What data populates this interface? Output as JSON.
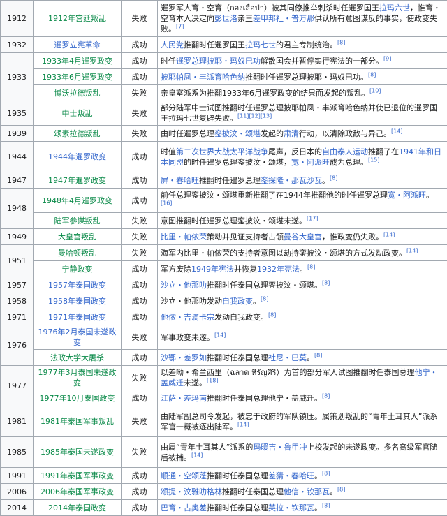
{
  "rows": [
    {
      "year": "1912",
      "event": "1912年宫廷叛乱",
      "event_link": true,
      "result": "失败",
      "desc": [
        {
          "t": "暹罗军人育・空育（",
          "c": "tx"
        },
        {
          "t": "กองเสือป่า",
          "c": "tx"
        },
        {
          "t": "）被其同僚推举刺杀时任暹罗国王",
          "c": "tx"
        },
        {
          "t": "拉玛六世",
          "c": "bl"
        },
        {
          "t": "，惟育・空育本人决定向",
          "c": "tx"
        },
        {
          "t": "彭世洛",
          "c": "bl"
        },
        {
          "t": "亲王",
          "c": "tx"
        },
        {
          "t": "差甲邦社・普万那",
          "c": "bl"
        },
        {
          "t": "供认所有意图谋反的事实，使政变失败。",
          "c": "tx"
        }
      ],
      "ref": "[7]"
    },
    {
      "year": "1932",
      "event": "暹罗立宪革命",
      "event_link": false,
      "result": "成功",
      "desc": [
        {
          "t": "人民党",
          "c": "bl"
        },
        {
          "t": "推翻时任暹罗国王",
          "c": "tx"
        },
        {
          "t": "拉玛七世",
          "c": "bl"
        },
        {
          "t": "的君主专制统治。",
          "c": "tx"
        }
      ],
      "ref": "[8]"
    },
    {
      "year": "1933",
      "event": "1933年4月暹罗政变",
      "event_link": true,
      "result": "成功",
      "desc": [
        {
          "t": "时任",
          "c": "tx"
        },
        {
          "t": "暹罗总理披耶・玛奴巴功",
          "c": "bl"
        },
        {
          "t": "解散国会并暂停实行宪法的一部分。",
          "c": "tx"
        }
      ],
      "ref": "[9]"
    },
    {
      "year": "",
      "event": "1933年6月暹罗政变",
      "event_link": true,
      "result": "成功",
      "desc": [
        {
          "t": "披耶帕凤・丰派育哈色纳",
          "c": "bl"
        },
        {
          "t": "推翻时任暹罗总理披耶・玛奴巴功。",
          "c": "tx"
        }
      ],
      "ref": "[8]"
    },
    {
      "year": "",
      "event": "博沃拉德叛乱",
      "event_link": true,
      "result": "失败",
      "desc": [
        {
          "t": "亲皇室派系为推翻1933年6月暹罗政变的结果而发起的叛乱。",
          "c": "tx"
        }
      ],
      "ref": "[10]"
    },
    {
      "year": "1935",
      "event": "中士叛乱",
      "event_link": true,
      "result": "失败",
      "desc": [
        {
          "t": "部分陆军中士试图推翻时任暹罗总理披耶帕凤・丰派育哈色纳并使已退位的暹罗国王拉玛七世复辟失败。",
          "c": "tx"
        }
      ],
      "ref": "[11][12][13]"
    },
    {
      "year": "1939",
      "event": "颂素拉德叛乱",
      "event_link": true,
      "result": "失败",
      "desc": [
        {
          "t": "由时任暹罗总理",
          "c": "tx"
        },
        {
          "t": "銮披汶・颂堪",
          "c": "bl"
        },
        {
          "t": "发起的",
          "c": "tx"
        },
        {
          "t": "肃清",
          "c": "bl"
        },
        {
          "t": "行动，以清除政敌与异己。",
          "c": "tx"
        }
      ],
      "ref": "[14]"
    },
    {
      "year": "1944",
      "event": "1944年暹罗政变",
      "event_link": false,
      "result": "成功",
      "desc": [
        {
          "t": "时值",
          "c": "tx"
        },
        {
          "t": "第二次世界大战太平洋战争",
          "c": "bl"
        },
        {
          "t": "尾声，反日本的",
          "c": "tx"
        },
        {
          "t": "自由泰人运动",
          "c": "bl"
        },
        {
          "t": "推翻了在",
          "c": "tx"
        },
        {
          "t": "1941年和日本同盟",
          "c": "bl"
        },
        {
          "t": "的时任暹罗总理銮披汶・颂堪，",
          "c": "tx"
        },
        {
          "t": "宽・阿派旺",
          "c": "bl"
        },
        {
          "t": "成为总理。",
          "c": "tx"
        }
      ],
      "ref": "[15]"
    },
    {
      "year": "1947",
      "event": "1947年暹罗政变",
      "event_link": true,
      "result": "成功",
      "desc": [
        {
          "t": "屏・春哈旺",
          "c": "bl"
        },
        {
          "t": "推翻时任暹罗总理",
          "c": "tx"
        },
        {
          "t": "銮探隆・那瓦沙瓦",
          "c": "bl"
        },
        {
          "t": "。",
          "c": "tx"
        }
      ],
      "ref": "[8]"
    },
    {
      "year": "1948",
      "event": "1948年4月暹罗政变",
      "event_link": true,
      "result": "成功",
      "desc": [
        {
          "t": "前任总理銮披汶・颂堪重新推翻了在1944年推翻他的时任暹罗总理",
          "c": "tx"
        },
        {
          "t": "宽・阿派旺",
          "c": "bl"
        },
        {
          "t": "。",
          "c": "tx"
        }
      ],
      "ref": "[16]"
    },
    {
      "year": "",
      "event": "陆军参谋叛乱",
      "event_link": true,
      "result": "失败",
      "desc": [
        {
          "t": "意图推翻时任暹罗总理銮披汶・颂堪未遂。",
          "c": "tx"
        }
      ],
      "ref": "[17]"
    },
    {
      "year": "1949",
      "event": "大皇宫叛乱",
      "event_link": true,
      "result": "失败",
      "desc": [
        {
          "t": "比里・帕侬荣",
          "c": "bl"
        },
        {
          "t": "策动并见证支持者占领",
          "c": "tx"
        },
        {
          "t": "曼谷大皇宫",
          "c": "bl"
        },
        {
          "t": "，惟政变仍失败。",
          "c": "tx"
        }
      ],
      "ref": "[14]"
    },
    {
      "year": "1951",
      "event": "曼哈顿叛乱",
      "event_link": true,
      "result": "失败",
      "desc": [
        {
          "t": "海军内比里・帕侬荣的支持者意图以劫持銮披汶・颂堪的方式发动政变。",
          "c": "tx"
        }
      ],
      "ref": "[14]"
    },
    {
      "year": "",
      "event": "宁静政变",
      "event_link": true,
      "result": "成功",
      "desc": [
        {
          "t": "军方废除",
          "c": "tx"
        },
        {
          "t": "1949年宪法",
          "c": "bl"
        },
        {
          "t": "并恢复",
          "c": "tx"
        },
        {
          "t": "1932年宪法",
          "c": "bl"
        },
        {
          "t": "。",
          "c": "tx"
        }
      ],
      "ref": "[8]"
    },
    {
      "year": "1957",
      "event": "1957年泰国政变",
      "event_link": false,
      "result": "成功",
      "desc": [
        {
          "t": "沙立・他那叻",
          "c": "bl"
        },
        {
          "t": "推翻时任泰国总理銮披汶・颂堪。",
          "c": "tx"
        }
      ],
      "ref": "[8]"
    },
    {
      "year": "1958",
      "event": "1958年泰国政变",
      "event_link": false,
      "result": "成功",
      "desc": [
        {
          "t": "沙立・他那叻发动",
          "c": "tx"
        },
        {
          "t": "自我政变",
          "c": "bl"
        },
        {
          "t": "。",
          "c": "tx"
        }
      ],
      "ref": "[8]"
    },
    {
      "year": "1971",
      "event": "1971年泰国政变",
      "event_link": false,
      "result": "成功",
      "desc": [
        {
          "t": "他侬・吉滴卡宗",
          "c": "bl"
        },
        {
          "t": "发动自我政变。",
          "c": "tx"
        }
      ],
      "ref": "[8]"
    },
    {
      "year": "1976",
      "event": "1976年2月泰国未遂政变",
      "event_link": false,
      "result": "失败",
      "desc": [
        {
          "t": "军事政变未遂。",
          "c": "tx"
        }
      ],
      "ref": "[14]"
    },
    {
      "year": "",
      "event": "法政大学大屠杀",
      "event_link": true,
      "result": "成功",
      "desc": [
        {
          "t": "沙鄂・差罗如",
          "c": "bl"
        },
        {
          "t": "推翻时任泰国总理",
          "c": "tx"
        },
        {
          "t": "社尼・巴莫",
          "c": "bl"
        },
        {
          "t": "。",
          "c": "tx"
        }
      ],
      "ref": "[8]"
    },
    {
      "year": "1977",
      "event": "1977年3月泰国未遂政变",
      "event_link": true,
      "result": "失败",
      "desc": [
        {
          "t": "以差呦・希兰西里（ฉลาด หิรัญศิริ）为首的部分军人试图推翻时任泰国总理",
          "c": "tx"
        },
        {
          "t": "他宁・盖威迁",
          "c": "bl"
        },
        {
          "t": "未遂。",
          "c": "tx"
        }
      ],
      "ref": "[18]"
    },
    {
      "year": "",
      "event": "1977年10月泰国政变",
      "event_link": true,
      "result": "成功",
      "desc": [
        {
          "t": "江萨・差玛南",
          "c": "bl"
        },
        {
          "t": "推翻时任泰国总理他宁・盖威迁。",
          "c": "tx"
        }
      ],
      "ref": "[8]"
    },
    {
      "year": "1981",
      "event": "1981年泰国军事叛乱",
      "event_link": true,
      "result": "失败",
      "desc": [
        {
          "t": "由陆军副总司令发起，被忠于政府的军队镇压。属策划叛乱的“青年土耳其人”派系军官一概被逐出陆军。",
          "c": "tx"
        }
      ],
      "ref": "[14]"
    },
    {
      "year": "1985",
      "event": "1985年泰国未遂政变",
      "event_link": true,
      "result": "失败",
      "desc": [
        {
          "t": "由属“青年土耳其人”派系的",
          "c": "tx"
        },
        {
          "t": "玛暖吉・鲁甲冲",
          "c": "bl"
        },
        {
          "t": "上校发起的未遂政变。多名高级军官随后被捕。",
          "c": "tx"
        }
      ],
      "ref": "[14]"
    },
    {
      "year": "1991",
      "event": "1991年泰国军事政变",
      "event_link": true,
      "result": "成功",
      "desc": [
        {
          "t": "顺通・空颂蓬",
          "c": "bl"
        },
        {
          "t": "推翻时任泰国总理",
          "c": "tx"
        },
        {
          "t": "差猜・春哈旺",
          "c": "bl"
        },
        {
          "t": "。",
          "c": "tx"
        }
      ],
      "ref": "[8]"
    },
    {
      "year": "2006",
      "event": "2006年泰国军事政变",
      "event_link": true,
      "result": "成功",
      "desc": [
        {
          "t": "颂提・汶雅叻格林",
          "c": "bl"
        },
        {
          "t": "推翻时任泰国总理",
          "c": "tx"
        },
        {
          "t": "他信・钦那瓦",
          "c": "bl"
        },
        {
          "t": "。",
          "c": "tx"
        }
      ],
      "ref": "[8]"
    },
    {
      "year": "2014",
      "event": "2014年泰国政变",
      "event_link": true,
      "result": "成功",
      "desc": [
        {
          "t": "巴育・占奥差",
          "c": "bl"
        },
        {
          "t": "推翻时任泰国总理",
          "c": "tx"
        },
        {
          "t": "英拉・钦那瓦",
          "c": "bl"
        },
        {
          "t": "。",
          "c": "tx"
        }
      ],
      "ref": "[8]"
    }
  ]
}
